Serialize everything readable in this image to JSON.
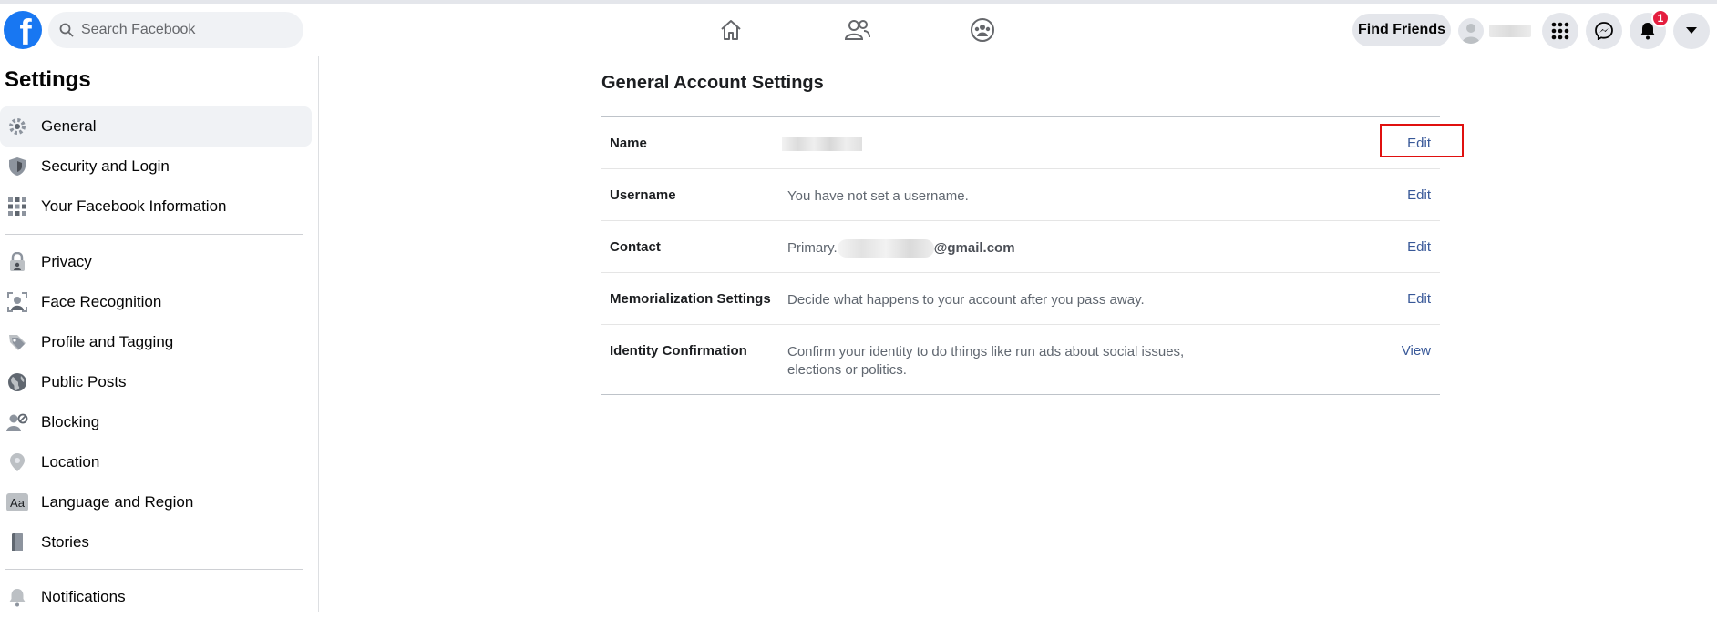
{
  "topbar": {
    "search_placeholder": "Search Facebook",
    "find_friends_label": "Find Friends",
    "notification_count": "1"
  },
  "sidebar": {
    "title": "Settings",
    "items": [
      {
        "label": "General",
        "icon": "gear-icon",
        "active": true
      },
      {
        "label": "Security and Login",
        "icon": "shield-icon"
      },
      {
        "label": "Your Facebook Information",
        "icon": "grid-info-icon"
      },
      {
        "label": "Privacy",
        "icon": "lock-icon"
      },
      {
        "label": "Face Recognition",
        "icon": "face-recognition-icon"
      },
      {
        "label": "Profile and Tagging",
        "icon": "tag-icon"
      },
      {
        "label": "Public Posts",
        "icon": "globe-icon"
      },
      {
        "label": "Blocking",
        "icon": "block-user-icon"
      },
      {
        "label": "Location",
        "icon": "location-pin-icon"
      },
      {
        "label": "Language and Region",
        "icon": "language-icon"
      },
      {
        "label": "Stories",
        "icon": "book-icon"
      },
      {
        "label": "Notifications",
        "icon": "bell-icon"
      }
    ]
  },
  "main": {
    "title": "General Account Settings",
    "rows": [
      {
        "label": "Name",
        "value": "",
        "action": "Edit"
      },
      {
        "label": "Username",
        "value": "You have not set a username.",
        "action": "Edit"
      },
      {
        "label": "Contact",
        "value_prefix": "Primary.",
        "value_domain": "@gmail.com",
        "action": "Edit"
      },
      {
        "label": "Memorialization Settings",
        "value": "Decide what happens to your account after you pass away.",
        "action": "Edit"
      },
      {
        "label": "Identity Confirmation",
        "value": "Confirm your identity to do things like run ads about social issues, elections or politics.",
        "action": "View"
      }
    ]
  },
  "colors": {
    "brand": "#1877f2",
    "link": "#385898",
    "highlight": "#e0100f",
    "badge": "#e41e3f"
  }
}
